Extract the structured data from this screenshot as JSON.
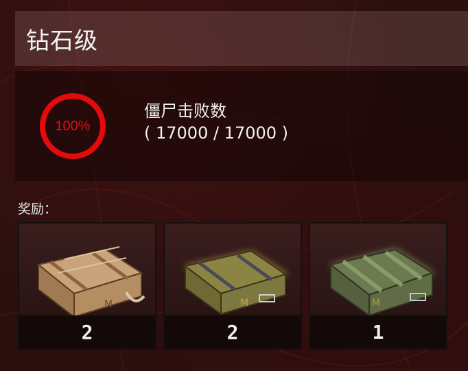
{
  "title": "钻石级",
  "progress": {
    "percent_label": "100%",
    "fraction": 1.0,
    "title": "僵尸击败数",
    "count_text": "( 17000 / 17000 )",
    "ring_color": "#e30b0b"
  },
  "rewards": {
    "label": "奖励：",
    "items": [
      {
        "icon": "wooden-crate-icon",
        "quantity": "2"
      },
      {
        "icon": "gold-metal-crate-icon",
        "quantity": "2"
      },
      {
        "icon": "green-military-crate-icon",
        "quantity": "1"
      }
    ]
  }
}
